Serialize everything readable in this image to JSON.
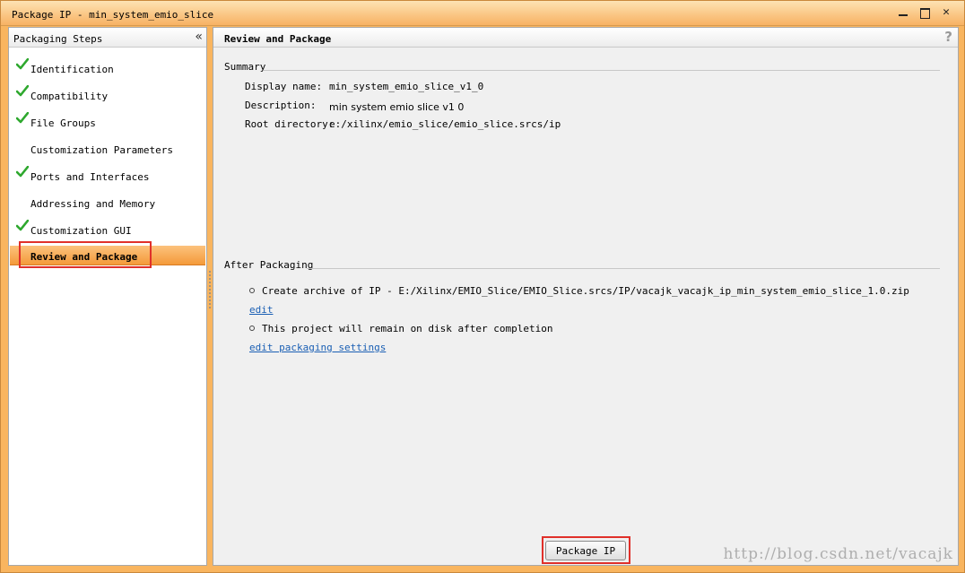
{
  "window": {
    "title": "Package IP - min_system_emio_slice"
  },
  "left_panel": {
    "header": "Packaging Steps",
    "steps": [
      {
        "label": "Identification",
        "checked": true
      },
      {
        "label": "Compatibility",
        "checked": true
      },
      {
        "label": "File Groups",
        "checked": true
      },
      {
        "label": "Customization Parameters",
        "checked": false
      },
      {
        "label": "Ports and Interfaces",
        "checked": true
      },
      {
        "label": "Addressing and Memory",
        "checked": false
      },
      {
        "label": "Customization GUI",
        "checked": true
      },
      {
        "label": "Review and Package",
        "checked": false,
        "active": true
      }
    ]
  },
  "right_panel": {
    "header": "Review and Package",
    "summary": {
      "title": "Summary",
      "display_name_label": "Display name:",
      "display_name_value": "min_system_emio_slice_v1_0",
      "description_label": "Description:",
      "description_value": "min system emio slice v1 0",
      "root_directory_label": "Root directory:",
      "root_directory_value": "e:/xilinx/emio_slice/emio_slice.srcs/ip"
    },
    "after_packaging": {
      "title": "After Packaging",
      "archive_text": "Create archive of IP - E:/Xilinx/EMIO_Slice/EMIO_Slice.srcs/IP/vacajk_vacajk_ip_min_system_emio_slice_1.0.zip",
      "edit_link": "edit",
      "remain_text": "This project will remain on disk after completion",
      "settings_link": "edit packaging settings"
    },
    "package_button": "Package IP"
  },
  "watermark": "http://blog.csdn.net/vacajk",
  "colors": {
    "accent_orange": "#f49a3a",
    "check_green": "#2ea82e",
    "highlight_red": "#e0302a",
    "link_blue": "#1a5fb4"
  }
}
